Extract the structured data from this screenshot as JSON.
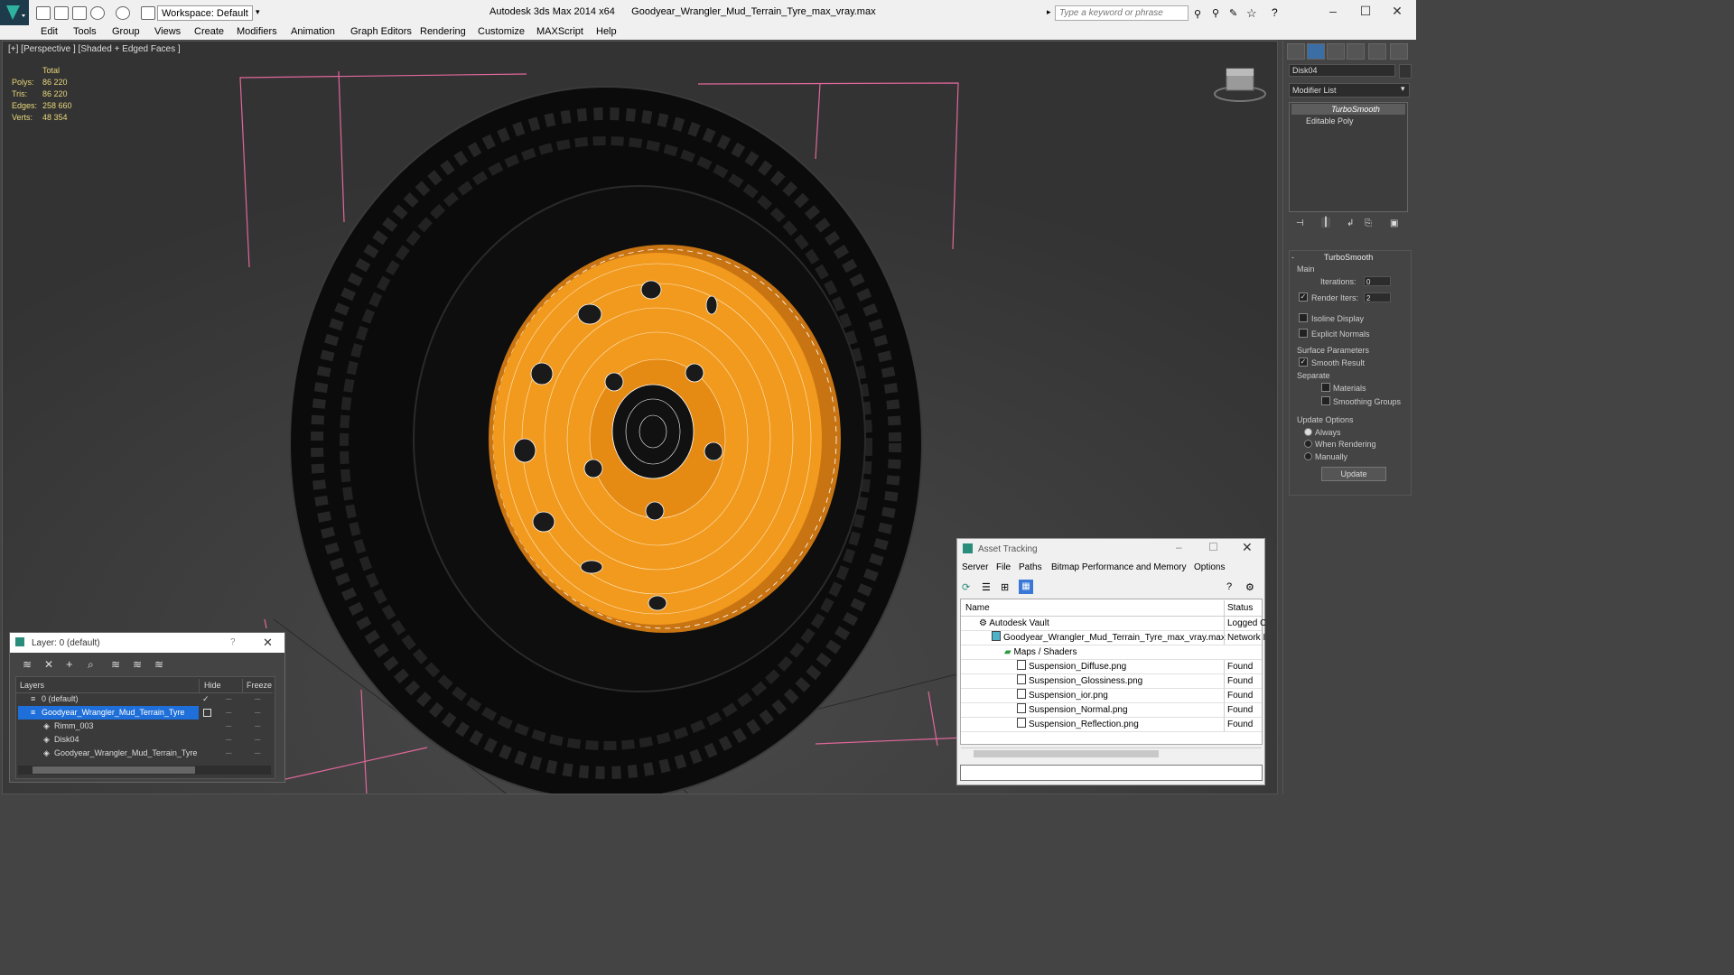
{
  "app": {
    "title": "Autodesk 3ds Max  2014 x64",
    "file": "Goodyear_Wrangler_Mud_Terrain_Tyre_max_vray.max",
    "workspace": "Workspace: Default",
    "search_placeholder": "Type a keyword or phrase"
  },
  "menu": [
    "Edit",
    "Tools",
    "Group",
    "Views",
    "Create",
    "Modifiers",
    "Animation",
    "Graph Editors",
    "Rendering",
    "Customize",
    "MAXScript",
    "Help"
  ],
  "viewport": {
    "label": "[+] [Perspective ] [Shaded + Edged Faces ]",
    "stats": {
      "header": "Total",
      "rows": [
        {
          "key": "Polys:",
          "value": "86 220"
        },
        {
          "key": "Tris:",
          "value": "86 220"
        },
        {
          "key": "Edges:",
          "value": "258 660"
        },
        {
          "key": "Verts:",
          "value": "48 354"
        }
      ]
    }
  },
  "command_panel": {
    "object_name": "Disk04",
    "modifier_list": "Modifier List",
    "stack": [
      "TurboSmooth",
      "Editable Poly"
    ],
    "rollout_title": "TurboSmooth",
    "main_group": "Main",
    "iterations_label": "Iterations:",
    "iterations_value": "0",
    "render_iters_label": "Render Iters:",
    "render_iters_value": "2",
    "isoline_label": "Isoline Display",
    "explicit_normals_label": "Explicit Normals",
    "surface_group": "Surface Parameters",
    "smooth_result_label": "Smooth Result",
    "separate_label": "Separate",
    "materials_label": "Materials",
    "smoothing_groups_label": "Smoothing Groups",
    "update_group": "Update Options",
    "always_label": "Always",
    "when_rendering_label": "When Rendering",
    "manually_label": "Manually",
    "update_button": "Update"
  },
  "layer_panel": {
    "title": "Layer: 0 (default)",
    "help": "?",
    "col_layers": "Layers",
    "col_hide": "Hide",
    "col_freeze": "Freeze",
    "rows": [
      {
        "label": "0 (default)"
      },
      {
        "label": "Goodyear_Wrangler_Mud_Terrain_Tyre"
      },
      {
        "label": "Rimm_003"
      },
      {
        "label": "Disk04"
      },
      {
        "label": "Goodyear_Wrangler_Mud_Terrain_Tyre"
      }
    ]
  },
  "asset_panel": {
    "title": "Asset Tracking",
    "menu": [
      "Server",
      "File",
      "Paths",
      "Bitmap Performance and Memory",
      "Options"
    ],
    "col_name": "Name",
    "col_status": "Status",
    "rows": [
      {
        "name": "Autodesk Vault",
        "status": "Logged C"
      },
      {
        "name": "Goodyear_Wrangler_Mud_Terrain_Tyre_max_vray.max",
        "status": "Network I"
      },
      {
        "name": "Maps / Shaders",
        "status": ""
      },
      {
        "name": "Suspension_Diffuse.png",
        "status": "Found"
      },
      {
        "name": "Suspension_Glossiness.png",
        "status": "Found"
      },
      {
        "name": "Suspension_ior.png",
        "status": "Found"
      },
      {
        "name": "Suspension_Normal.png",
        "status": "Found"
      },
      {
        "name": "Suspension_Reflection.png",
        "status": "Found"
      }
    ]
  },
  "colors": {
    "rim": "#f29a1e",
    "tyre": "#0e0e0e",
    "selection": "#1e6fd9",
    "bbox": "#e0679a"
  }
}
